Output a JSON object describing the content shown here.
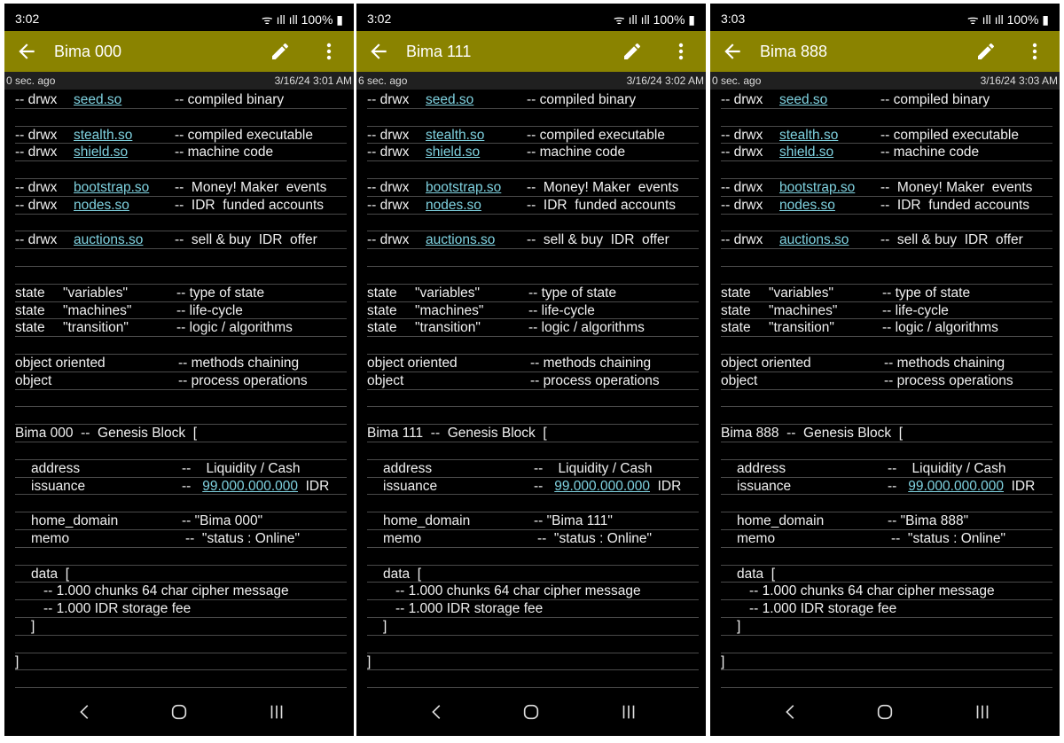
{
  "screens": [
    {
      "status_time": "3:02",
      "status_battery": "100%",
      "title": "Bima 000",
      "ago": "0 sec. ago",
      "timestamp": "3/16/24 3:01 AM",
      "genesis_name": "Bima 000",
      "home_domain": "\"Bima 000\""
    },
    {
      "status_time": "3:02",
      "status_battery": "100%",
      "title": "Bima 111",
      "ago": "6 sec. ago",
      "timestamp": "3/16/24 3:02 AM",
      "genesis_name": "Bima 111",
      "home_domain": "\"Bima 111\""
    },
    {
      "status_time": "3:03",
      "status_battery": "100%",
      "title": "Bima 888",
      "ago": "0 sec. ago",
      "timestamp": "3/16/24 3:03 AM",
      "genesis_name": "Bima 888",
      "home_domain": "\"Bima 888\""
    }
  ],
  "text": {
    "drwx": "-- drwx",
    "seed": "seed.so",
    "seed_desc": "-- compiled binary",
    "stealth": "stealth.so",
    "stealth_desc": "-- compiled executable",
    "shield": "shield.so",
    "shield_desc": "-- machine code",
    "bootstrap": "bootstrap.so",
    "bootstrap_desc": "--  Money! Maker  events",
    "nodes": "nodes.so",
    "nodes_desc": "--  IDR  funded accounts",
    "auctions": "auctions.so",
    "auctions_desc": "--  sell & buy  IDR  offer",
    "state": "state",
    "variables": "\"variables\"",
    "variables_desc": "-- type of state",
    "machines": "\"machines\"",
    "machines_desc": "-- life-cycle",
    "transition": "\"transition\"",
    "transition_desc": "-- logic / algorithms",
    "object_oriented": "object oriented",
    "object_oriented_desc": "-- methods chaining",
    "object": "object",
    "object_desc": "-- process operations",
    "genesis_suffix": "  --  Genesis Block  [",
    "address": "address",
    "address_desc": "--    Liquidity / Cash",
    "issuance": "issuance",
    "issuance_dash": "--",
    "issuance_value": "99.000.000.000",
    "issuance_unit": "IDR",
    "home_domain_label": "home_domain",
    "dash": "--",
    "memo": "memo",
    "memo_value": "--  \"status : Online\"",
    "data_open": "data  [",
    "data_chunks": "-- 1.000 chunks 64 char cipher message",
    "data_fee": "-- 1.000 IDR storage fee",
    "bracket": "]"
  }
}
